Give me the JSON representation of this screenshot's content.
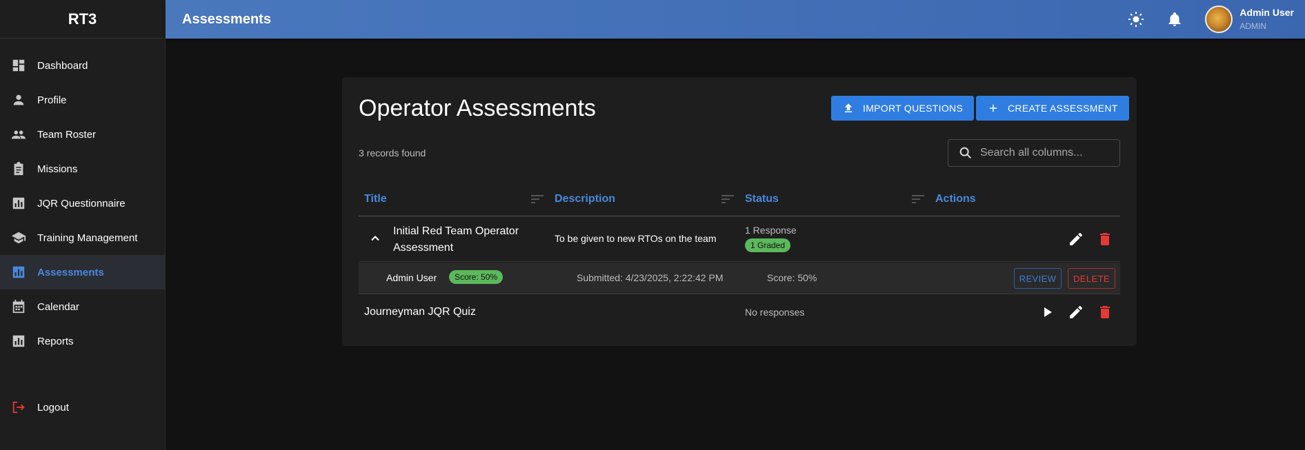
{
  "sidebar": {
    "brand": "RT3",
    "items": [
      {
        "label": "Dashboard",
        "icon": "dashboard-icon"
      },
      {
        "label": "Profile",
        "icon": "person-icon"
      },
      {
        "label": "Team Roster",
        "icon": "people-icon"
      },
      {
        "label": "Missions",
        "icon": "clipboard-icon"
      },
      {
        "label": "JQR Questionnaire",
        "icon": "bar-chart-icon"
      },
      {
        "label": "Training Management",
        "icon": "school-icon"
      },
      {
        "label": "Assessments",
        "icon": "bar-chart-icon",
        "active": true
      },
      {
        "label": "Calendar",
        "icon": "calendar-icon"
      },
      {
        "label": "Reports",
        "icon": "bar-chart-icon"
      }
    ],
    "logout": "Logout"
  },
  "header": {
    "title": "Assessments",
    "user_name": "Admin User",
    "user_role": "ADMIN"
  },
  "main": {
    "title": "Operator Assessments",
    "import_label": "IMPORT QUESTIONS",
    "create_label": "CREATE ASSESSMENT",
    "records_count": "3 records found",
    "search_placeholder": "Search all columns...",
    "columns": [
      "Title",
      "Description",
      "Status",
      "Actions"
    ],
    "rows": [
      {
        "title_line1": "Initial Red Team Operator",
        "title_line2": "Assessment",
        "description": "To be given to new RTOs on the team",
        "status": "1 Response",
        "badge": "1 Graded",
        "responses": [
          {
            "user": "Admin User",
            "score_badge": "Score: 50%",
            "submitted": "Submitted: 4/23/2025, 2:22:42 PM",
            "score": "Score: 50%",
            "review_label": "REVIEW",
            "delete_label": "DELETE"
          }
        ]
      },
      {
        "title": "Journeyman JQR Quiz",
        "status": "No responses"
      }
    ]
  },
  "colors": {
    "accent": "#2f7de1",
    "header": "#3d6cb4",
    "success": "#5cb85c",
    "danger": "#e53935",
    "link": "#4a89dc"
  }
}
